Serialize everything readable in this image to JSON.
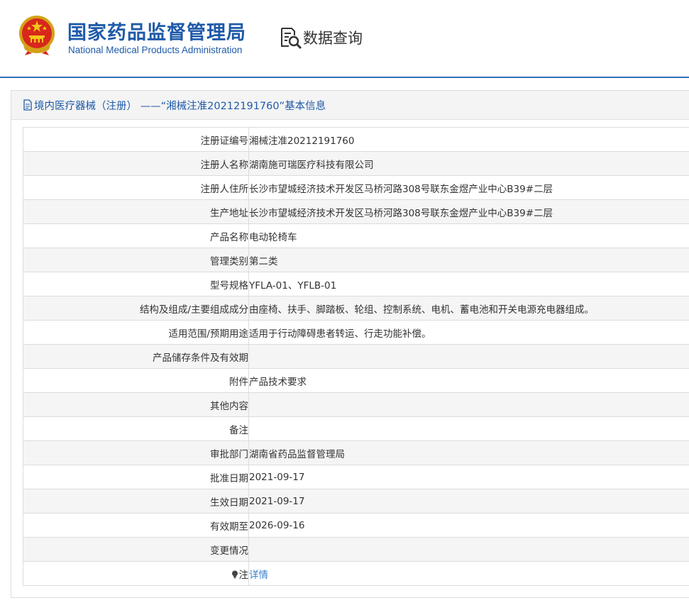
{
  "header": {
    "title_cn": "国家药品监督管理局",
    "title_en": "National Medical Products Administration",
    "query_label": "数据查询",
    "emblem_icon": "national-emblem-icon",
    "query_icon": "document-search-icon"
  },
  "panel": {
    "title": "境内医疗器械（注册） ——“湘械注准20212191760”基本信息",
    "title_icon": "document-icon"
  },
  "rows": [
    {
      "label": "注册证编号",
      "value": "湘械注准20212191760"
    },
    {
      "label": "注册人名称",
      "value": "湖南施可瑞医疗科技有限公司"
    },
    {
      "label": "注册人住所",
      "value": "长沙市望城经济技术开发区马桥河路308号联东金煜产业中心B39#二层"
    },
    {
      "label": "生产地址",
      "value": "长沙市望城经济技术开发区马桥河路308号联东金煜产业中心B39#二层"
    },
    {
      "label": "产品名称",
      "value": "电动轮椅车"
    },
    {
      "label": "管理类别",
      "value": "第二类"
    },
    {
      "label": "型号规格",
      "value": "YFLA-01、YFLB-01"
    },
    {
      "label": "结构及组成/主要组成成分",
      "value": "由座椅、扶手、脚踏板、轮组、控制系统、电机、蓄电池和开关电源充电器组成。"
    },
    {
      "label": "适用范围/预期用途",
      "value": "适用于行动障碍患者转运、行走功能补偿。"
    },
    {
      "label": "产品储存条件及有效期",
      "value": ""
    },
    {
      "label": "附件",
      "value": "产品技术要求"
    },
    {
      "label": "其他内容",
      "value": ""
    },
    {
      "label": "备注",
      "value": ""
    },
    {
      "label": "审批部门",
      "value": "湖南省药品监督管理局"
    },
    {
      "label": "批准日期",
      "value": "2021-09-17"
    },
    {
      "label": "生效日期",
      "value": "2021-09-17"
    },
    {
      "label": "有效期至",
      "value": "2026-09-16"
    },
    {
      "label": "变更情况",
      "value": ""
    }
  ],
  "note_row": {
    "label": "注",
    "icon": "lightbulb-icon",
    "link_text": "详情"
  },
  "colors": {
    "brand_blue": "#1f5aa8",
    "link_blue": "#3a7fc9",
    "header_line": "#2e6fb7"
  }
}
